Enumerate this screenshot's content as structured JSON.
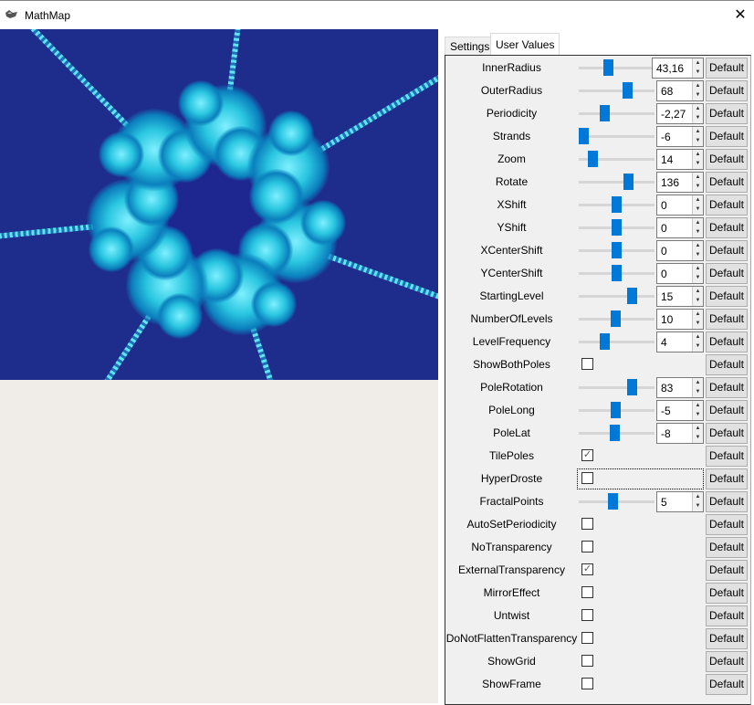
{
  "window": {
    "title": "MathMap",
    "close": "✕"
  },
  "tabs": [
    {
      "label": "Settings"
    },
    {
      "label": "User Values"
    }
  ],
  "default_label": "Default",
  "rows": [
    {
      "label": "InnerRadius",
      "type": "slider",
      "value": "43,16",
      "fraction": 0.38
    },
    {
      "label": "OuterRadius",
      "type": "slider",
      "value": "68",
      "fraction": 0.67
    },
    {
      "label": "Periodicity",
      "type": "slider",
      "value": "-2,27",
      "fraction": 0.32
    },
    {
      "label": "Strands",
      "type": "slider",
      "value": "-6",
      "fraction": 0.0
    },
    {
      "label": "Zoom",
      "type": "slider",
      "value": "14",
      "fraction": 0.14
    },
    {
      "label": "Rotate",
      "type": "slider",
      "value": "136",
      "fraction": 0.68
    },
    {
      "label": "XShift",
      "type": "slider",
      "value": "0",
      "fraction": 0.5
    },
    {
      "label": "YShift",
      "type": "slider",
      "value": "0",
      "fraction": 0.5
    },
    {
      "label": "XCenterShift",
      "type": "slider",
      "value": "0",
      "fraction": 0.5
    },
    {
      "label": "YCenterShift",
      "type": "slider",
      "value": "0",
      "fraction": 0.5
    },
    {
      "label": "StartingLevel",
      "type": "slider",
      "value": "15",
      "fraction": 0.73
    },
    {
      "label": "NumberOfLevels",
      "type": "slider",
      "value": "10",
      "fraction": 0.48
    },
    {
      "label": "LevelFrequency",
      "type": "slider",
      "value": "4",
      "fraction": 0.32
    },
    {
      "label": "ShowBothPoles",
      "type": "check",
      "checked": false
    },
    {
      "label": "PoleRotation",
      "type": "slider",
      "value": "83",
      "fraction": 0.73
    },
    {
      "label": "PoleLong",
      "type": "slider",
      "value": "-5",
      "fraction": 0.48
    },
    {
      "label": "PoleLat",
      "type": "slider",
      "value": "-8",
      "fraction": 0.47
    },
    {
      "label": "TilePoles",
      "type": "check",
      "checked": true
    },
    {
      "label": "HyperDroste",
      "type": "check",
      "checked": false,
      "focused": true
    },
    {
      "label": "FractalPoints",
      "type": "slider",
      "value": "5",
      "fraction": 0.45
    },
    {
      "label": "AutoSetPeriodicity",
      "type": "check",
      "checked": false
    },
    {
      "label": "NoTransparency",
      "type": "check",
      "checked": false
    },
    {
      "label": "ExternalTransparency",
      "type": "check",
      "checked": true
    },
    {
      "label": "MirrorEffect",
      "type": "check",
      "checked": false
    },
    {
      "label": "Untwist",
      "type": "check",
      "checked": false
    },
    {
      "label": "DoNotFlattenTransparency",
      "type": "check",
      "checked": false
    },
    {
      "label": "ShowGrid",
      "type": "check",
      "checked": false
    },
    {
      "label": "ShowFrame",
      "type": "check",
      "checked": false
    }
  ]
}
